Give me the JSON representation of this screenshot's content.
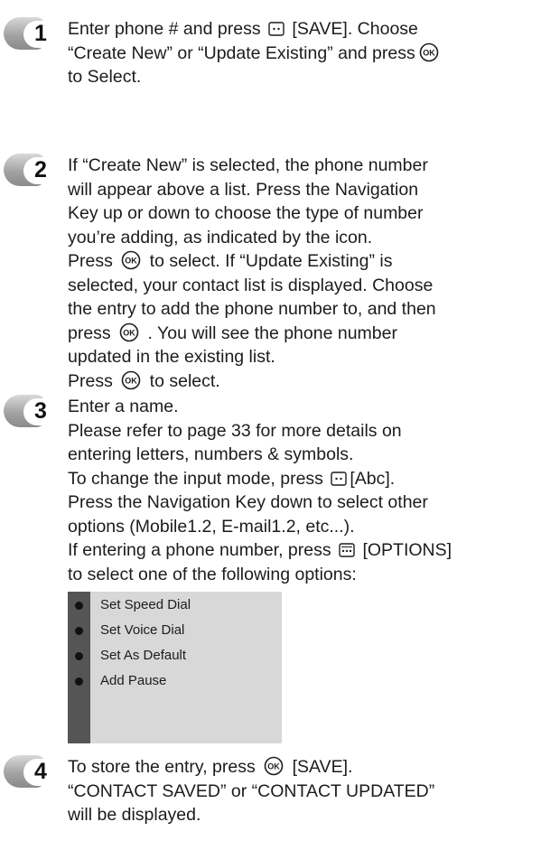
{
  "steps": [
    {
      "number": "1",
      "lines": [
        [
          {
            "t": "Enter phone # and press "
          },
          {
            "icon": "soft-key"
          },
          {
            "t": " [SAVE]. Choose"
          }
        ],
        [
          {
            "t": "“Create New” or “Update Existing” and press"
          },
          {
            "icon": "ok-key"
          }
        ],
        [
          {
            "t": "to Select."
          }
        ]
      ]
    },
    {
      "number": "2",
      "lines": [
        [
          {
            "t": "If “Create New” is selected, the phone number"
          }
        ],
        [
          {
            "t": "will appear above a list. Press the Navigation"
          }
        ],
        [
          {
            "t": "Key up or down to choose the type of number"
          }
        ],
        [
          {
            "t": "you’re adding, as indicated by the icon."
          }
        ],
        [
          {
            "t": "Press "
          },
          {
            "icon": "ok-key"
          },
          {
            "t": " to select. If “Update Existing” is"
          }
        ],
        [
          {
            "t": "selected, your contact list is displayed. Choose"
          }
        ],
        [
          {
            "t": "the entry to add the phone number to, and then"
          }
        ],
        [
          {
            "t": "press "
          },
          {
            "icon": "ok-key"
          },
          {
            "t": " . You will see the phone number"
          }
        ],
        [
          {
            "t": "updated in the existing list."
          }
        ],
        [
          {
            "t": "Press "
          },
          {
            "icon": "ok-key"
          },
          {
            "t": " to select."
          }
        ]
      ]
    },
    {
      "number": "3",
      "lines": [
        [
          {
            "t": "Enter a name."
          }
        ],
        [
          {
            "t": "Please refer to page 33 for more details on"
          }
        ],
        [
          {
            "t": "entering letters, numbers & symbols."
          }
        ],
        [
          {
            "t": "To change the input mode, press "
          },
          {
            "icon": "soft-key"
          },
          {
            "t": "[Abc]."
          }
        ],
        [
          {
            "t": "Press the Navigation Key down to select other"
          }
        ],
        [
          {
            "t": "options (Mobile1.2, E-mail1.2, etc...)."
          }
        ],
        [
          {
            "t": "If entering a phone number, press "
          },
          {
            "icon": "options-key"
          },
          {
            "t": " [OPTIONS]"
          }
        ],
        [
          {
            "t": "to select one of the following options:"
          }
        ]
      ]
    },
    {
      "number": "4",
      "lines": [
        [
          {
            "t": "To store the entry, press "
          },
          {
            "icon": "ok-key"
          },
          {
            "t": " [SAVE]."
          }
        ],
        [
          {
            "t": "“CONTACT SAVED” or “CONTACT UPDATED”"
          }
        ],
        [
          {
            "t": "will be displayed."
          }
        ]
      ]
    }
  ],
  "options": [
    "Set Speed Dial",
    "Set Voice Dial",
    "Set As Default",
    "Add Pause"
  ],
  "icon_glyphs": {
    "ok-key": "OK"
  },
  "colors": {
    "text": "#1c1c1c",
    "badge": "#a3a3a3",
    "options_bg": "#d8d8d8",
    "options_rail": "#555555"
  }
}
